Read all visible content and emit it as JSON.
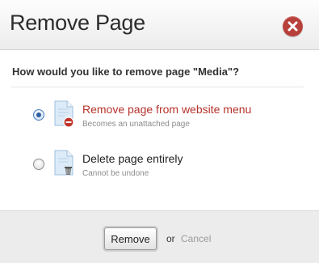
{
  "dialog": {
    "title": "Remove Page",
    "close_icon": "close-icon",
    "question": "How would you like to remove page \"Media\"?"
  },
  "options": [
    {
      "label": "Remove page from website menu",
      "sublabel": "Becomes an unattached page",
      "selected": true,
      "icon": "page-remove-icon"
    },
    {
      "label": "Delete page entirely",
      "sublabel": "Cannot be undone",
      "selected": false,
      "icon": "page-trash-icon"
    }
  ],
  "footer": {
    "remove_label": "Remove",
    "or_text": "or",
    "cancel_label": "Cancel"
  },
  "colors": {
    "close_button": "#b8403a",
    "active_option_label": "#b5322b",
    "page_icon": "#dcebf7"
  }
}
